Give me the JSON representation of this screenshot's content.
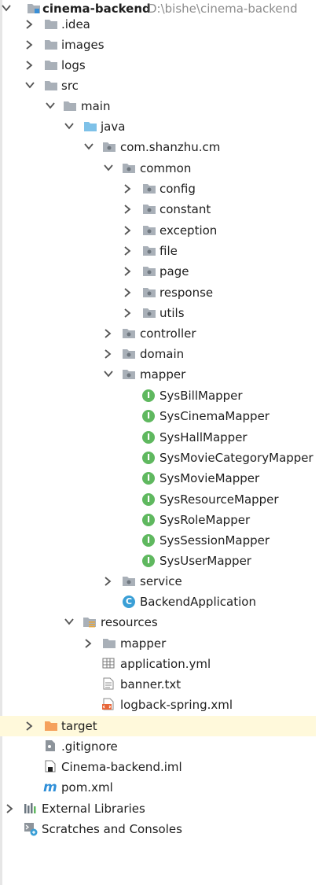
{
  "project": {
    "name": "cinema-backend",
    "path": "D:\\bishe\\cinema-backend"
  },
  "tree": {
    "idea": ".idea",
    "images": "images",
    "logs": "logs",
    "src": "src",
    "main": "main",
    "java": "java",
    "package": "com.shanzhu.cm",
    "common": "common",
    "common_children": [
      "config",
      "constant",
      "exception",
      "file",
      "page",
      "response",
      "utils"
    ],
    "controller": "controller",
    "domain": "domain",
    "mapper": "mapper",
    "mappers": [
      "SysBillMapper",
      "SysCinemaMapper",
      "SysHallMapper",
      "SysMovieCategoryMapper",
      "SysMovieMapper",
      "SysResourceMapper",
      "SysRoleMapper",
      "SysSessionMapper",
      "SysUserMapper"
    ],
    "service": "service",
    "backend_application": "BackendApplication",
    "resources": "resources",
    "res_mapper": "mapper",
    "application_yml": "application.yml",
    "banner_txt": "banner.txt",
    "logback_xml": "logback-spring.xml",
    "target": "target",
    "gitignore": ".gitignore",
    "iml": "Cinema-backend.iml",
    "pom": "pom.xml",
    "external_libraries": "External Libraries",
    "scratches": "Scratches and Consoles"
  },
  "badges": {
    "interface_letter": "I",
    "class_letter": "C",
    "maven_letter": "m"
  },
  "colors": {
    "folder_gray": "#a9b0b8",
    "folder_blue": "#7ec1e8",
    "folder_orange": "#f5a15c",
    "interface_green": "#5fb85f",
    "class_blue": "#3a9fd6",
    "excluded_bg": "#fff9db"
  }
}
